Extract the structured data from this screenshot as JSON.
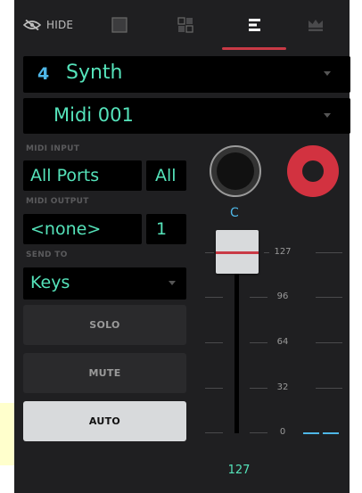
{
  "toolbar": {
    "hide_label": "HIDE",
    "tabs": [
      {
        "icon": "square-icon",
        "active": false
      },
      {
        "icon": "pad-grid-icon",
        "active": false
      },
      {
        "icon": "mixer-bars-icon",
        "active": true
      },
      {
        "icon": "crown-icon",
        "active": false
      }
    ]
  },
  "track": {
    "number": "4",
    "name": "Synth"
  },
  "program": {
    "name": "Midi 001"
  },
  "midi_input": {
    "label": "MIDI INPUT",
    "port": "All Ports",
    "channel": "All"
  },
  "midi_output": {
    "label": "MIDI OUTPUT",
    "port": "<none>",
    "channel": "1"
  },
  "send_to": {
    "label": "SEND TO",
    "value": "Keys"
  },
  "buttons": {
    "solo": "SOLO",
    "mute": "MUTE",
    "auto": "AUTO"
  },
  "pan": {
    "label": "C"
  },
  "fader": {
    "scale": [
      "127",
      "96",
      "64",
      "32",
      "0"
    ],
    "value": "127"
  },
  "colors": {
    "accent_green": "#55e3ba",
    "accent_blue": "#4eb6e6",
    "record_red": "#d23240",
    "panel_bg": "#1f1f21"
  }
}
